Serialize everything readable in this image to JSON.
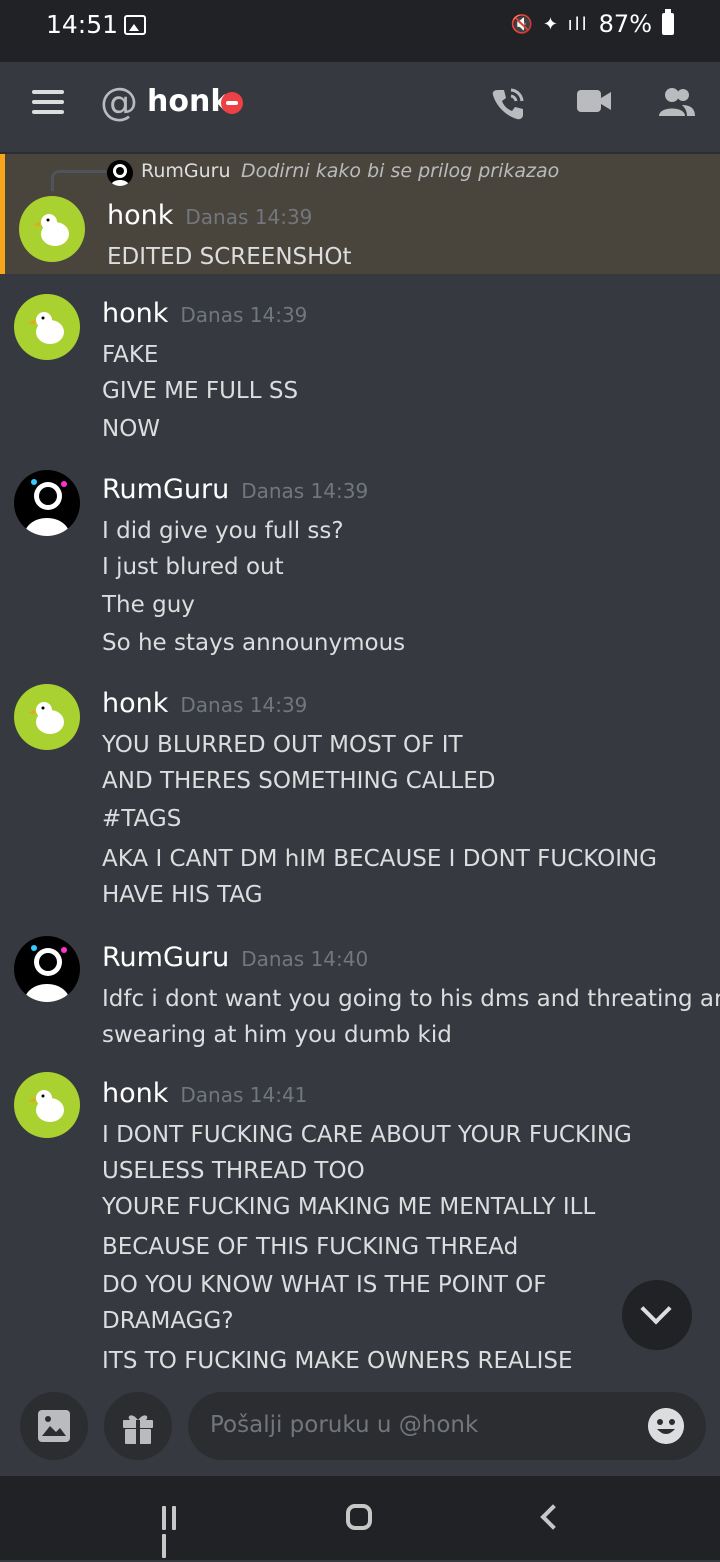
{
  "status_bar": {
    "time": "14:51",
    "battery": "87%",
    "icons": "🔇 ✦ ıll"
  },
  "header": {
    "channel_name": "honk"
  },
  "reply_preview": {
    "author": "RumGuru",
    "text": "Dodirni kako bi se prilog prikazao"
  },
  "messages": [
    {
      "author": "honk",
      "time": "Danas 14:39",
      "lines": [
        "EDITED SCREENSHOt"
      ]
    },
    {
      "author": "honk",
      "time": "Danas 14:39",
      "lines": [
        "FAKE",
        "GIVE ME FULL SS",
        "NOW"
      ]
    },
    {
      "author": "RumGuru",
      "time": "Danas 14:39",
      "lines": [
        "I did give you full ss?",
        "I just blured out",
        "The guy",
        "So he stays announymous"
      ]
    },
    {
      "author": "honk",
      "time": "Danas 14:39",
      "lines": [
        "YOU BLURRED OUT MOST OF IT",
        "AND THERES SOMETHING CALLED",
        "#TAGS",
        "AKA I CANT DM hIM BECAUSE I DONT FUCKOING",
        "HAVE HIS TAG"
      ]
    },
    {
      "author": "RumGuru",
      "time": "Danas 14:40",
      "lines": [
        "Idfc i dont want you going to his dms and threating and",
        "swearing at him you dumb kid"
      ]
    },
    {
      "author": "honk",
      "time": "Danas 14:41",
      "lines": [
        "I DONT FUCKING CARE ABOUT YOUR FUCKING",
        "USELESS THREAD TOO",
        "YOURE FUCKING MAKING ME MENTALLY ILL",
        "BECAUSE OF THIS FUCKING THREAd",
        "DO YOU KNOW WHAT IS THE POINT OF",
        "DRAMAGG?",
        "ITS TO FUCKING MAKE OWNERS REALISE"
      ]
    }
  ],
  "composer": {
    "placeholder": "Pošalji poruku u @honk"
  }
}
